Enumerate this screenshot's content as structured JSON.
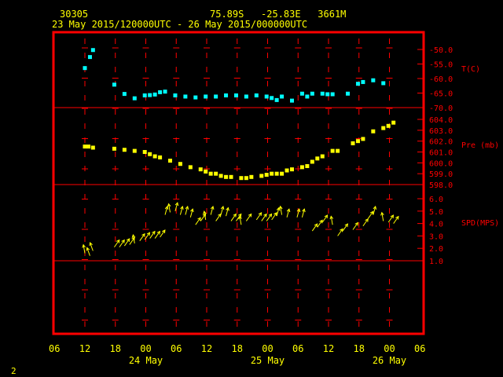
{
  "header": {
    "station": "30305",
    "location": "75.89S   -25.83E   3661M",
    "period": "23 May 2015/120000UTC - 26 May 2015/000000UTC"
  },
  "page_number": "2",
  "colors": {
    "frame": "#ff0000",
    "tick_marks": "#ff0000",
    "labels": "#ffff00",
    "axis_labels_right": "#ff0000",
    "temperature": "#00ffff",
    "pressure": "#ffff00",
    "wind": "#ffff00",
    "background": "#000000"
  },
  "chart_data": {
    "type": "scatter",
    "x_axis": {
      "unit": "hour",
      "range": [
        -6,
        66
      ],
      "tick_labels": [
        "06",
        "12",
        "18",
        "00",
        "06",
        "12",
        "18",
        "00",
        "06",
        "12",
        "18",
        "00",
        "06"
      ],
      "tick_values": [
        -6,
        0,
        6,
        12,
        18,
        24,
        30,
        36,
        42,
        48,
        54,
        60,
        66
      ],
      "day_labels": [
        {
          "label": "24 May",
          "x": 12
        },
        {
          "label": "25 May",
          "x": 36
        },
        {
          "label": "26 May",
          "x": 60
        }
      ]
    },
    "panels": [
      {
        "name": "temperature",
        "ylabel": "T(C)",
        "tick_labels": [
          "-50.0",
          "-55.0",
          "-60.0",
          "-65.0",
          "-70.0"
        ],
        "tick_values": [
          -50,
          -55,
          -60,
          -65,
          -70
        ],
        "ylim": [
          -70,
          -50
        ],
        "points": [
          [
            0,
            -56.4
          ],
          [
            1,
            -52.6
          ],
          [
            1.6,
            -50.2
          ],
          [
            5.8,
            -62.1
          ],
          [
            7.8,
            -65.3
          ],
          [
            9.8,
            -66.8
          ],
          [
            11.8,
            -65.8
          ],
          [
            12.8,
            -65.7
          ],
          [
            13.8,
            -65.5
          ],
          [
            14.8,
            -64.7
          ],
          [
            15.8,
            -64.5
          ],
          [
            17.8,
            -65.8
          ],
          [
            19.8,
            -66.2
          ],
          [
            21.8,
            -66.5
          ],
          [
            23.8,
            -66.2
          ],
          [
            25.8,
            -66.2
          ],
          [
            27.8,
            -65.8
          ],
          [
            29.8,
            -65.8
          ],
          [
            31.8,
            -66.2
          ],
          [
            33.8,
            -65.8
          ],
          [
            35.8,
            -66.2
          ],
          [
            36.8,
            -66.7
          ],
          [
            37.8,
            -67.4
          ],
          [
            38.8,
            -66.2
          ],
          [
            40.8,
            -67.6
          ],
          [
            42.8,
            -65.2
          ],
          [
            43.8,
            -66.2
          ],
          [
            44.8,
            -65.2
          ],
          [
            46.8,
            -65.2
          ],
          [
            47.8,
            -65.4
          ],
          [
            48.8,
            -65.4
          ],
          [
            51.8,
            -65.2
          ],
          [
            53.8,
            -61.8
          ],
          [
            54.8,
            -61.2
          ],
          [
            56.8,
            -60.6
          ],
          [
            58.8,
            -61.6
          ]
        ]
      },
      {
        "name": "pressure",
        "ylabel": "Pre (mb)",
        "tick_labels": [
          "604.0",
          "603.0",
          "602.0",
          "601.0",
          "600.0",
          "599.0",
          "598.0"
        ],
        "tick_values": [
          604,
          603,
          602,
          601,
          600,
          599,
          598
        ],
        "ylim": [
          598,
          604
        ],
        "points": [
          [
            0,
            601.5
          ],
          [
            0.7,
            601.5
          ],
          [
            1.6,
            601.4
          ],
          [
            5.8,
            601.3
          ],
          [
            7.8,
            601.2
          ],
          [
            9.8,
            601.1
          ],
          [
            11.8,
            601.0
          ],
          [
            12.8,
            600.8
          ],
          [
            13.8,
            600.6
          ],
          [
            14.8,
            600.5
          ],
          [
            16.8,
            600.2
          ],
          [
            18.8,
            599.9
          ],
          [
            20.8,
            599.6
          ],
          [
            22.8,
            599.4
          ],
          [
            23.8,
            599.2
          ],
          [
            24.8,
            599.0
          ],
          [
            25.8,
            599.0
          ],
          [
            26.8,
            598.8
          ],
          [
            27.8,
            598.7
          ],
          [
            28.8,
            598.7
          ],
          [
            30.8,
            598.6
          ],
          [
            31.8,
            598.6
          ],
          [
            32.8,
            598.7
          ],
          [
            34.8,
            598.8
          ],
          [
            35.8,
            598.9
          ],
          [
            36.8,
            599.0
          ],
          [
            37.8,
            599.0
          ],
          [
            38.8,
            599.0
          ],
          [
            39.8,
            599.3
          ],
          [
            40.8,
            599.4
          ],
          [
            42.8,
            599.6
          ],
          [
            43.8,
            599.7
          ],
          [
            44.8,
            600.1
          ],
          [
            45.8,
            600.4
          ],
          [
            46.8,
            600.6
          ],
          [
            48.8,
            601.1
          ],
          [
            49.8,
            601.1
          ],
          [
            52.8,
            601.8
          ],
          [
            53.8,
            602.0
          ],
          [
            54.8,
            602.2
          ],
          [
            56.8,
            602.9
          ],
          [
            58.8,
            603.2
          ],
          [
            59.8,
            603.4
          ],
          [
            60.8,
            603.7
          ]
        ]
      },
      {
        "name": "wind",
        "ylabel": "SPD(MPS)",
        "tick_labels": [
          "6.0",
          "5.0",
          "4.0",
          "3.0",
          "2.0",
          "1.0"
        ],
        "tick_values": [
          6,
          5,
          4,
          3,
          2,
          1
        ],
        "ylim": [
          1,
          6
        ],
        "points": [
          [
            0,
            1.6
          ],
          [
            1,
            1.4
          ],
          [
            1.6,
            1.8
          ],
          [
            5.8,
            2.1
          ],
          [
            6.8,
            2.1
          ],
          [
            7.8,
            2.2
          ],
          [
            8.8,
            2.3
          ],
          [
            9.8,
            2.4
          ],
          [
            10.8,
            2.6
          ],
          [
            11.8,
            2.7
          ],
          [
            12.8,
            2.8
          ],
          [
            13.8,
            2.8
          ],
          [
            14.8,
            2.9
          ],
          [
            15.8,
            4.7
          ],
          [
            16.8,
            4.9
          ],
          [
            17.8,
            5.0
          ],
          [
            18.8,
            4.7
          ],
          [
            19.8,
            4.7
          ],
          [
            20.8,
            4.5
          ],
          [
            21.8,
            3.9
          ],
          [
            22.8,
            4.2
          ],
          [
            23.8,
            4.3
          ],
          [
            24.8,
            4.7
          ],
          [
            25.8,
            4.2
          ],
          [
            26.8,
            4.7
          ],
          [
            27.8,
            4.6
          ],
          [
            28.8,
            4.2
          ],
          [
            29.8,
            4.2
          ],
          [
            30.8,
            3.9
          ],
          [
            31.8,
            4.2
          ],
          [
            33.8,
            4.3
          ],
          [
            34.8,
            4.2
          ],
          [
            35.8,
            4.2
          ],
          [
            36.8,
            4.3
          ],
          [
            37.8,
            4.6
          ],
          [
            38.8,
            4.7
          ],
          [
            39.8,
            4.5
          ],
          [
            41.8,
            4.5
          ],
          [
            42.8,
            4.5
          ],
          [
            44.8,
            3.4
          ],
          [
            45.8,
            3.7
          ],
          [
            46.8,
            4.1
          ],
          [
            48.8,
            3.9
          ],
          [
            49.8,
            3.0
          ],
          [
            50.8,
            3.4
          ],
          [
            52.8,
            3.5
          ],
          [
            54.8,
            3.8
          ],
          [
            55.8,
            4.4
          ],
          [
            56.8,
            4.7
          ],
          [
            58.8,
            4.2
          ],
          [
            59.8,
            4.1
          ],
          [
            60.8,
            4.0
          ]
        ]
      }
    ]
  }
}
